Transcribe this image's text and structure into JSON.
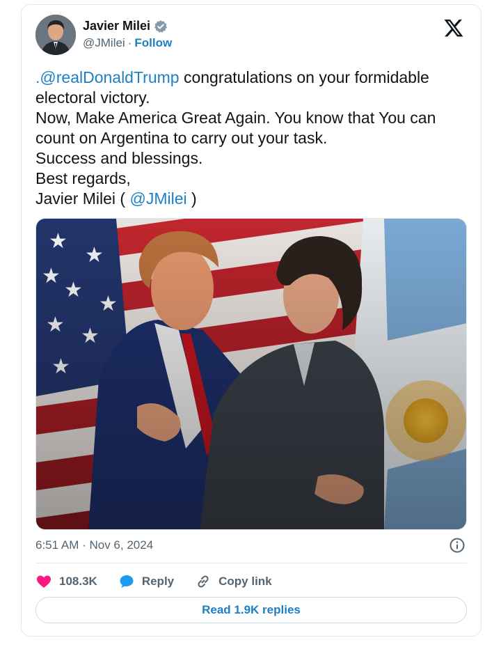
{
  "author": {
    "display_name": "Javier Milei",
    "handle": "@JMilei",
    "separator": "·",
    "follow_label": "Follow",
    "verified_color": "#829aab"
  },
  "tweet": {
    "lines": [
      {
        "mention": ".@realDonaldTrump",
        "text": " congratulations on your formidable"
      },
      {
        "text": "electoral victory."
      },
      {
        "text": "Now, Make America Great Again. You know that You can"
      },
      {
        "text": "count on Argentina to carry out your task."
      },
      {
        "text": "Success and blessings."
      },
      {
        "text": "Best regards,"
      },
      {
        "text": "Javier Milei ( ",
        "mention": "@JMilei",
        "suffix": " )"
      }
    ]
  },
  "media": {
    "icon": "photo-two-men-embracing-flags"
  },
  "meta": {
    "timestamp": "6:51 AM · Nov 6, 2024"
  },
  "actions": {
    "likes": "108.3K",
    "reply_label": "Reply",
    "copy_link_label": "Copy link"
  },
  "read_replies_label": "Read 1.9K replies",
  "colors": {
    "accent": "#1d7fc4",
    "like": "#f91880",
    "reply": "#1d9bf0",
    "muted": "#536471"
  }
}
